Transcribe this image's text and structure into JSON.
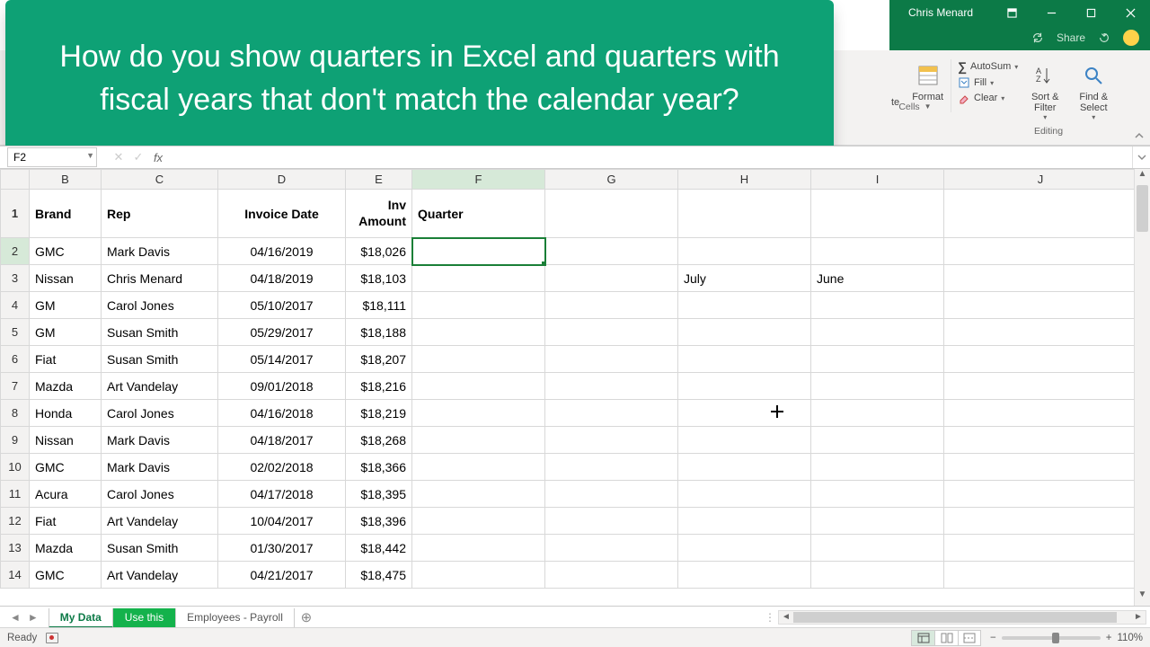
{
  "titlebar": {
    "user": "Chris Menard"
  },
  "quickbar": {
    "share": "Share"
  },
  "overlay": {
    "text": "How do you show quarters in Excel and quarters with fiscal years that don't match the calendar year?"
  },
  "ribbon": {
    "cells": {
      "format_label": "Format",
      "group": "Cells",
      "delete_suffix": "te"
    },
    "editing": {
      "autosum": "AutoSum",
      "fill": "Fill",
      "clear": "Clear",
      "sort_filter": "Sort &\nFilter",
      "find_select": "Find &\nSelect",
      "group": "Editing"
    }
  },
  "namebox": "F2",
  "columns": [
    "B",
    "C",
    "D",
    "E",
    "F",
    "G",
    "H",
    "I",
    "J"
  ],
  "headers": {
    "brand": "Brand",
    "rep": "Rep",
    "invoice_date": "Invoice Date",
    "inv_amount": "Inv Amount",
    "quarter": "Quarter"
  },
  "rows": [
    {
      "n": "1"
    },
    {
      "n": "2",
      "b": "GMC",
      "c": "Mark Davis",
      "d": "04/16/2019",
      "e": "$18,026"
    },
    {
      "n": "3",
      "b": "Nissan",
      "c": "Chris Menard",
      "d": "04/18/2019",
      "e": "$18,103",
      "h": "July",
      "i": "June"
    },
    {
      "n": "4",
      "b": "GM",
      "c": "Carol Jones",
      "d": "05/10/2017",
      "e": "$18,111"
    },
    {
      "n": "5",
      "b": "GM",
      "c": "Susan Smith",
      "d": "05/29/2017",
      "e": "$18,188"
    },
    {
      "n": "6",
      "b": "Fiat",
      "c": "Susan Smith",
      "d": "05/14/2017",
      "e": "$18,207"
    },
    {
      "n": "7",
      "b": "Mazda",
      "c": "Art Vandelay",
      "d": "09/01/2018",
      "e": "$18,216"
    },
    {
      "n": "8",
      "b": "Honda",
      "c": "Carol Jones",
      "d": "04/16/2018",
      "e": "$18,219"
    },
    {
      "n": "9",
      "b": "Nissan",
      "c": "Mark Davis",
      "d": "04/18/2017",
      "e": "$18,268"
    },
    {
      "n": "10",
      "b": "GMC",
      "c": "Mark Davis",
      "d": "02/02/2018",
      "e": "$18,366"
    },
    {
      "n": "11",
      "b": "Acura",
      "c": "Carol Jones",
      "d": "04/17/2018",
      "e": "$18,395"
    },
    {
      "n": "12",
      "b": "Fiat",
      "c": "Art Vandelay",
      "d": "10/04/2017",
      "e": "$18,396"
    },
    {
      "n": "13",
      "b": "Mazda",
      "c": "Susan Smith",
      "d": "01/30/2017",
      "e": "$18,442"
    },
    {
      "n": "14",
      "b": "GMC",
      "c": "Art Vandelay",
      "d": "04/21/2017",
      "e": "$18,475"
    }
  ],
  "sheets": {
    "mydata": "My Data",
    "usethis": "Use this",
    "emp": "Employees - Payroll"
  },
  "status": {
    "ready": "Ready",
    "zoom": "110%"
  }
}
